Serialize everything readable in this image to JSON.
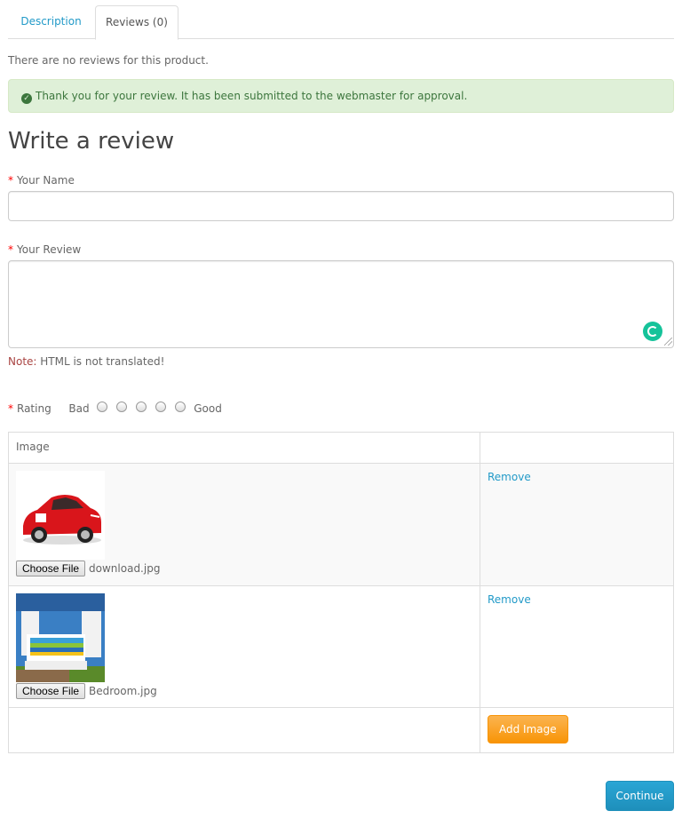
{
  "tabs": [
    {
      "label": "Description",
      "active": false
    },
    {
      "label": "Reviews (0)",
      "active": true
    }
  ],
  "no_reviews_text": "There are no reviews for this product.",
  "alert": {
    "text": "Thank you for your review. It has been submitted to the webmaster for approval.",
    "icon": "check-circle-icon"
  },
  "form": {
    "heading": "Write a review",
    "name_label": "Your Name",
    "name_value": "",
    "review_label": "Your Review",
    "review_value": "",
    "note_key": "Note:",
    "note_text": " HTML is not translated!",
    "rating_label": "Rating",
    "rating_bad": "Bad",
    "rating_good": "Good",
    "rating_options": 5,
    "rating_selected": null
  },
  "image_table": {
    "header": "Image",
    "rows": [
      {
        "file_button": "Choose File",
        "file_name": "download.jpg",
        "remove_label": "Remove",
        "thumbnail": "red-sports-car"
      },
      {
        "file_button": "Choose File",
        "file_name": "Bedroom.jpg",
        "remove_label": "Remove",
        "thumbnail": "kids-bedroom"
      }
    ],
    "add_button": "Add Image"
  },
  "continue_button": "Continue",
  "colors": {
    "link": "#229ac8",
    "alert_bg": "#dff0d8",
    "alert_text": "#3c763d",
    "orange": "#f89406",
    "primary": "#229ac8",
    "required": "#ff0000"
  }
}
